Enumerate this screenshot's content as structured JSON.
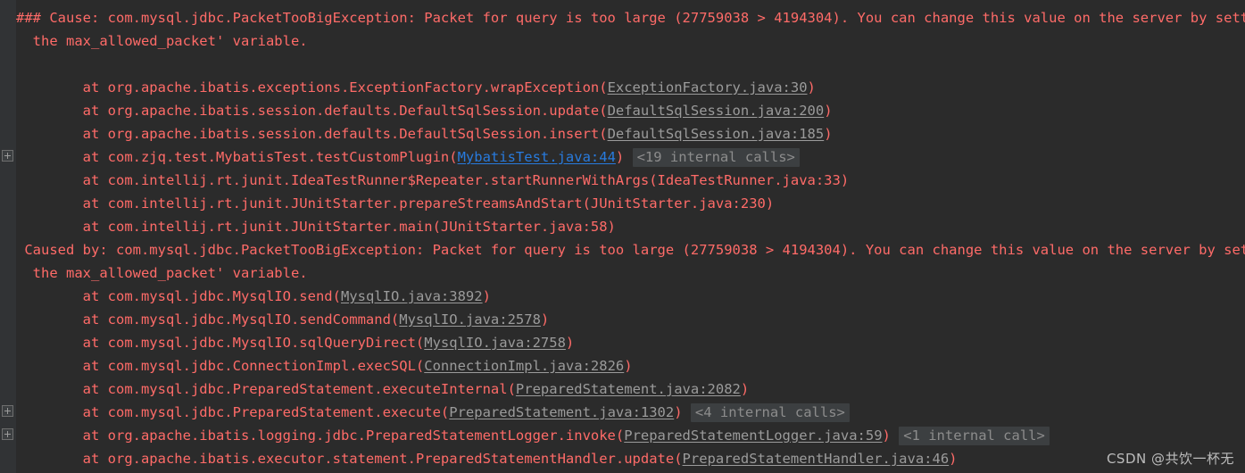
{
  "console": {
    "background_color": "#2b2b2b",
    "gutter_color": "#313335",
    "error_text_color": "#ff6b68",
    "link_gray_color": "#9b9b9b",
    "link_blue_color": "#287bde",
    "badge_bg_color": "#3c3f41",
    "badge_text_color": "#8c8c8c",
    "lines": [
      {
        "id": "cause-header-1",
        "expandable": false,
        "segments": [
          {
            "kind": "text",
            "value": "### Cause: com.mysql.jdbc.PacketTooBigException: Packet for query is too large (27759038 > 4194304). You can change this value on the server by setting"
          }
        ]
      },
      {
        "id": "cause-header-2",
        "expandable": false,
        "segments": [
          {
            "kind": "text",
            "value": "  the max_allowed_packet' variable."
          }
        ]
      },
      {
        "id": "blank-1",
        "expandable": false,
        "segments": [
          {
            "kind": "text",
            "value": " "
          }
        ]
      },
      {
        "id": "frame-exceptionfactory-wrapexception",
        "expandable": false,
        "segments": [
          {
            "kind": "text",
            "value": "\tat org.apache.ibatis.exceptions.ExceptionFactory.wrapException("
          },
          {
            "kind": "link-gray",
            "value": "ExceptionFactory.java:30"
          },
          {
            "kind": "text",
            "value": ")"
          }
        ]
      },
      {
        "id": "frame-defaultsqlsession-update",
        "expandable": false,
        "segments": [
          {
            "kind": "text",
            "value": "\tat org.apache.ibatis.session.defaults.DefaultSqlSession.update("
          },
          {
            "kind": "link-gray",
            "value": "DefaultSqlSession.java:200"
          },
          {
            "kind": "text",
            "value": ")"
          }
        ]
      },
      {
        "id": "frame-defaultsqlsession-insert",
        "expandable": false,
        "segments": [
          {
            "kind": "text",
            "value": "\tat org.apache.ibatis.session.defaults.DefaultSqlSession.insert("
          },
          {
            "kind": "link-gray",
            "value": "DefaultSqlSession.java:185"
          },
          {
            "kind": "text",
            "value": ")"
          }
        ]
      },
      {
        "id": "frame-mybatistest-testcustomplugin",
        "expandable": true,
        "segments": [
          {
            "kind": "text",
            "value": "\tat com.zjq.test.MybatisTest.testCustomPlugin("
          },
          {
            "kind": "link-blue",
            "value": "MybatisTest.java:44"
          },
          {
            "kind": "text",
            "value": ") "
          },
          {
            "kind": "badge",
            "value": "<19 internal calls>"
          }
        ]
      },
      {
        "id": "frame-ideatestrunner-startrunnerwithargs",
        "expandable": false,
        "segments": [
          {
            "kind": "text",
            "value": "\tat com.intellij.rt.junit.IdeaTestRunner$Repeater.startRunnerWithArgs(IdeaTestRunner.java:33)"
          }
        ]
      },
      {
        "id": "frame-junitstarter-preparestreamsandstart",
        "expandable": false,
        "segments": [
          {
            "kind": "text",
            "value": "\tat com.intellij.rt.junit.JUnitStarter.prepareStreamsAndStart(JUnitStarter.java:230)"
          }
        ]
      },
      {
        "id": "frame-junitstarter-main",
        "expandable": false,
        "segments": [
          {
            "kind": "text",
            "value": "\tat com.intellij.rt.junit.JUnitStarter.main(JUnitStarter.java:58)"
          }
        ]
      },
      {
        "id": "caused-by-header-1",
        "expandable": false,
        "segments": [
          {
            "kind": "text",
            "value": " Caused by: com.mysql.jdbc.PacketTooBigException: Packet for query is too large (27759038 > 4194304). You can change this value on the server by setting"
          }
        ]
      },
      {
        "id": "caused-by-header-2",
        "expandable": false,
        "segments": [
          {
            "kind": "text",
            "value": "  the max_allowed_packet' variable."
          }
        ]
      },
      {
        "id": "frame-mysqlio-send",
        "expandable": false,
        "segments": [
          {
            "kind": "text",
            "value": "\tat com.mysql.jdbc.MysqlIO.send("
          },
          {
            "kind": "link-gray",
            "value": "MysqlIO.java:3892"
          },
          {
            "kind": "text",
            "value": ")"
          }
        ]
      },
      {
        "id": "frame-mysqlio-sendcommand",
        "expandable": false,
        "segments": [
          {
            "kind": "text",
            "value": "\tat com.mysql.jdbc.MysqlIO.sendCommand("
          },
          {
            "kind": "link-gray",
            "value": "MysqlIO.java:2578"
          },
          {
            "kind": "text",
            "value": ")"
          }
        ]
      },
      {
        "id": "frame-mysqlio-sqlquerydirect",
        "expandable": false,
        "segments": [
          {
            "kind": "text",
            "value": "\tat com.mysql.jdbc.MysqlIO.sqlQueryDirect("
          },
          {
            "kind": "link-gray",
            "value": "MysqlIO.java:2758"
          },
          {
            "kind": "text",
            "value": ")"
          }
        ]
      },
      {
        "id": "frame-connectionimpl-execsql",
        "expandable": false,
        "segments": [
          {
            "kind": "text",
            "value": "\tat com.mysql.jdbc.ConnectionImpl.execSQL("
          },
          {
            "kind": "link-gray",
            "value": "ConnectionImpl.java:2826"
          },
          {
            "kind": "text",
            "value": ")"
          }
        ]
      },
      {
        "id": "frame-preparedstatement-executeinternal",
        "expandable": false,
        "segments": [
          {
            "kind": "text",
            "value": "\tat com.mysql.jdbc.PreparedStatement.executeInternal("
          },
          {
            "kind": "link-gray",
            "value": "PreparedStatement.java:2082"
          },
          {
            "kind": "text",
            "value": ")"
          }
        ]
      },
      {
        "id": "frame-preparedstatement-execute",
        "expandable": true,
        "segments": [
          {
            "kind": "text",
            "value": "\tat com.mysql.jdbc.PreparedStatement.execute("
          },
          {
            "kind": "link-gray",
            "value": "PreparedStatement.java:1302"
          },
          {
            "kind": "text",
            "value": ") "
          },
          {
            "kind": "badge",
            "value": "<4 internal calls>"
          }
        ]
      },
      {
        "id": "frame-preparedstatementlogger-invoke",
        "expandable": true,
        "segments": [
          {
            "kind": "text",
            "value": "\tat org.apache.ibatis.logging.jdbc.PreparedStatementLogger.invoke("
          },
          {
            "kind": "link-gray",
            "value": "PreparedStatementLogger.java:59"
          },
          {
            "kind": "text",
            "value": ") "
          },
          {
            "kind": "badge",
            "value": "<1 internal call>"
          }
        ]
      },
      {
        "id": "frame-preparedstatementhandler-update",
        "expandable": false,
        "segments": [
          {
            "kind": "text",
            "value": "\tat org.apache.ibatis.executor.statement.PreparedStatementHandler.update("
          },
          {
            "kind": "link-gray",
            "value": "PreparedStatementHandler.java:46"
          },
          {
            "kind": "text",
            "value": ")"
          }
        ]
      }
    ]
  },
  "watermark": {
    "text": "CSDN @共饮一杯无"
  }
}
